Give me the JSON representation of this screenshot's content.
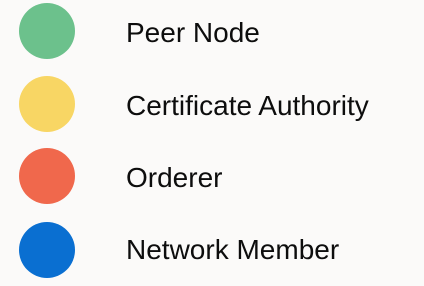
{
  "legend": {
    "items": [
      {
        "label": "Peer Node",
        "color": "#6cc18c",
        "icon": "green-circle-icon"
      },
      {
        "label": "Certificate Authority",
        "color": "#f8d664",
        "icon": "yellow-circle-icon"
      },
      {
        "label": "Orderer",
        "color": "#f0684c",
        "icon": "orange-circle-icon"
      },
      {
        "label": "Network Member",
        "color": "#0a6fd1",
        "icon": "blue-circle-icon"
      }
    ]
  }
}
